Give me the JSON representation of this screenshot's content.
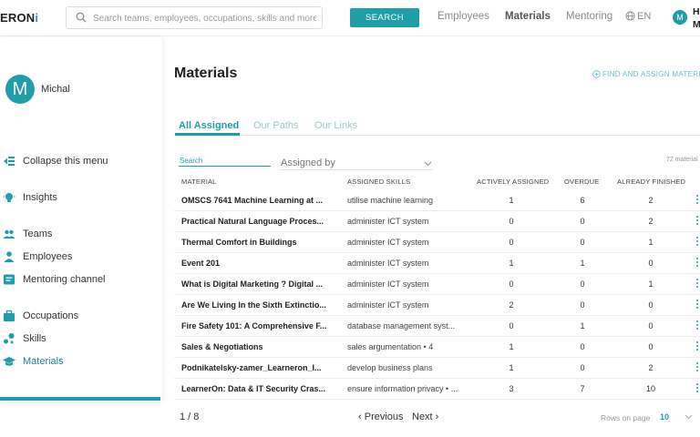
{
  "header": {
    "logo_text": "ERON",
    "logo_accent": "i",
    "search_placeholder": "Search teams, employees, occupations, skills and more",
    "search_button": "SEARCH",
    "nav": [
      {
        "label": "Employees",
        "active": false
      },
      {
        "label": "Materials",
        "active": true
      },
      {
        "label": "Mentoring",
        "active": false
      }
    ],
    "language": "EN",
    "user_initial": "M",
    "user_initials_line1": "H",
    "user_initials_line2": "M"
  },
  "sidebar": {
    "avatar_initial": "M",
    "user_name": "Michal",
    "items": [
      {
        "label": "Collapse this menu",
        "icon": "collapse-menu-icon"
      },
      {
        "label": "Insights",
        "icon": "lightbulb-icon"
      },
      {
        "label": "Teams",
        "icon": "teams-icon"
      },
      {
        "label": "Employees",
        "icon": "person-icon"
      },
      {
        "label": "Mentoring channel",
        "icon": "chat-icon"
      },
      {
        "label": "Occupations",
        "icon": "briefcase-icon"
      },
      {
        "label": "Skills",
        "icon": "skills-icon"
      },
      {
        "label": "Materials",
        "icon": "graduation-cap-icon"
      }
    ]
  },
  "main": {
    "title": "Materials",
    "find_assign": "FIND AND ASSIGN MATERIAL",
    "tabs": [
      {
        "label": "All Assigned",
        "active": true
      },
      {
        "label": "Our Paths",
        "active": false
      },
      {
        "label": "Our Links",
        "active": false
      }
    ],
    "filter_search_label": "Search",
    "assigned_by_label": "Assigned by",
    "material_count": "72 material",
    "table": {
      "headers": [
        "MATERIAL",
        "ASSIGNED SKILLS",
        "ACTIVELY ASSIGNED",
        "OVERDUE",
        "ALREADY FINISHED"
      ],
      "rows": [
        {
          "name": "OMSCS 7641 Machine Learning at ...",
          "skill": "utilise machine learning",
          "active": "1",
          "overdue": "6",
          "finished": "2"
        },
        {
          "name": "Practical Natural Language Proces...",
          "skill": "administer ICT system",
          "active": "0",
          "overdue": "0",
          "finished": "2"
        },
        {
          "name": "Thermal Comfort in Buildings",
          "skill": "administer ICT system",
          "active": "0",
          "overdue": "0",
          "finished": "1"
        },
        {
          "name": "Event 201",
          "skill": "administer ICT system",
          "active": "1",
          "overdue": "1",
          "finished": "0"
        },
        {
          "name": "What is Digital Marketing ? Digital ...",
          "skill": "administer ICT system",
          "active": "0",
          "overdue": "0",
          "finished": "1"
        },
        {
          "name": "Are We Living In the Sixth Extinctio...",
          "skill": "administer ICT system",
          "active": "2",
          "overdue": "0",
          "finished": "0"
        },
        {
          "name": "Fire Safety 101: A Comprehensive F...",
          "skill": "database management syst...",
          "active": "0",
          "overdue": "1",
          "finished": "0"
        },
        {
          "name": "Sales & Negotiations",
          "skill": "sales argumentation • 4",
          "active": "1",
          "overdue": "0",
          "finished": "0"
        },
        {
          "name": "Podnikatelsky-zamer_Learneron_I...",
          "skill": "develop business plans",
          "active": "1",
          "overdue": "0",
          "finished": "2"
        },
        {
          "name": "LearnerOn: Data & IT Security Cras...",
          "skill": "ensure information privacy • ...",
          "active": "3",
          "overdue": "7",
          "finished": "10"
        }
      ]
    },
    "pager": {
      "page_text": "1 / 8",
      "prev": "Previous",
      "next": "Next",
      "rows_label": "Rows on page",
      "rows_value": "10"
    }
  },
  "colors": {
    "accent": "#1f9ea8",
    "accent_light": "#9fc9cd"
  }
}
